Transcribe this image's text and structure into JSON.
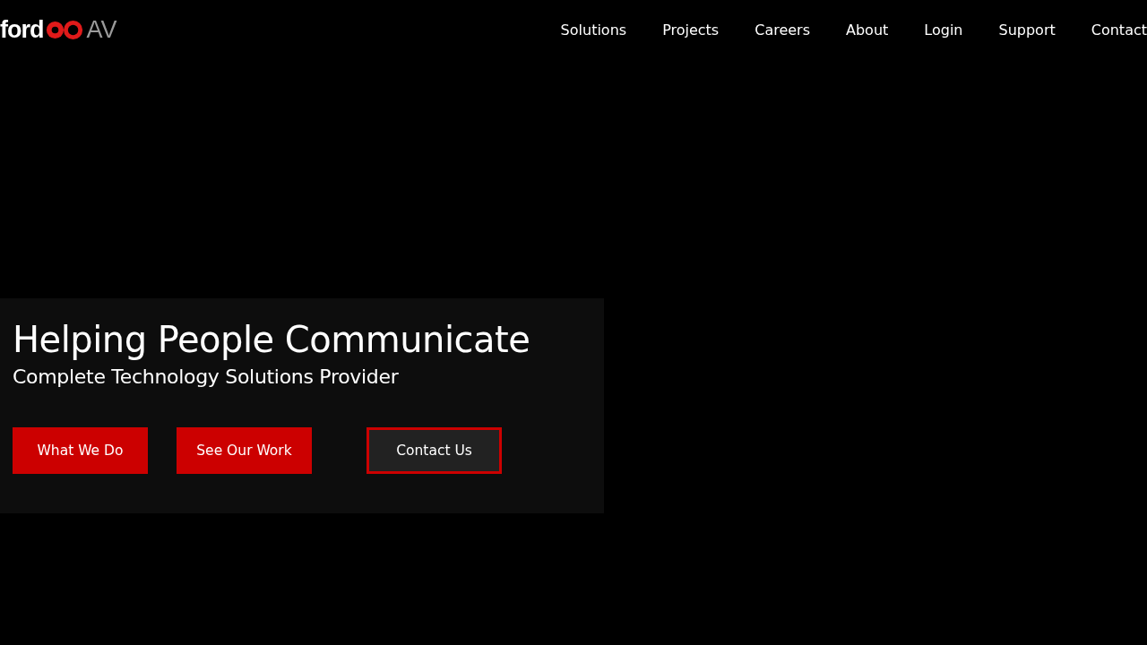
{
  "logo": {
    "word": "ford",
    "suffix": "AV"
  },
  "nav": [
    {
      "label": "Solutions"
    },
    {
      "label": "Projects"
    },
    {
      "label": "Careers"
    },
    {
      "label": "About"
    },
    {
      "label": "Login"
    },
    {
      "label": "Support"
    },
    {
      "label": "Contact"
    }
  ],
  "hero": {
    "title": "Helping People Communicate",
    "subtitle": "Complete Technology Solutions Provider",
    "buttons": [
      {
        "label": "What We Do",
        "kind": "primary"
      },
      {
        "label": "See Our Work",
        "kind": "primary"
      },
      {
        "label": "Contact Us",
        "kind": "outline"
      }
    ]
  }
}
